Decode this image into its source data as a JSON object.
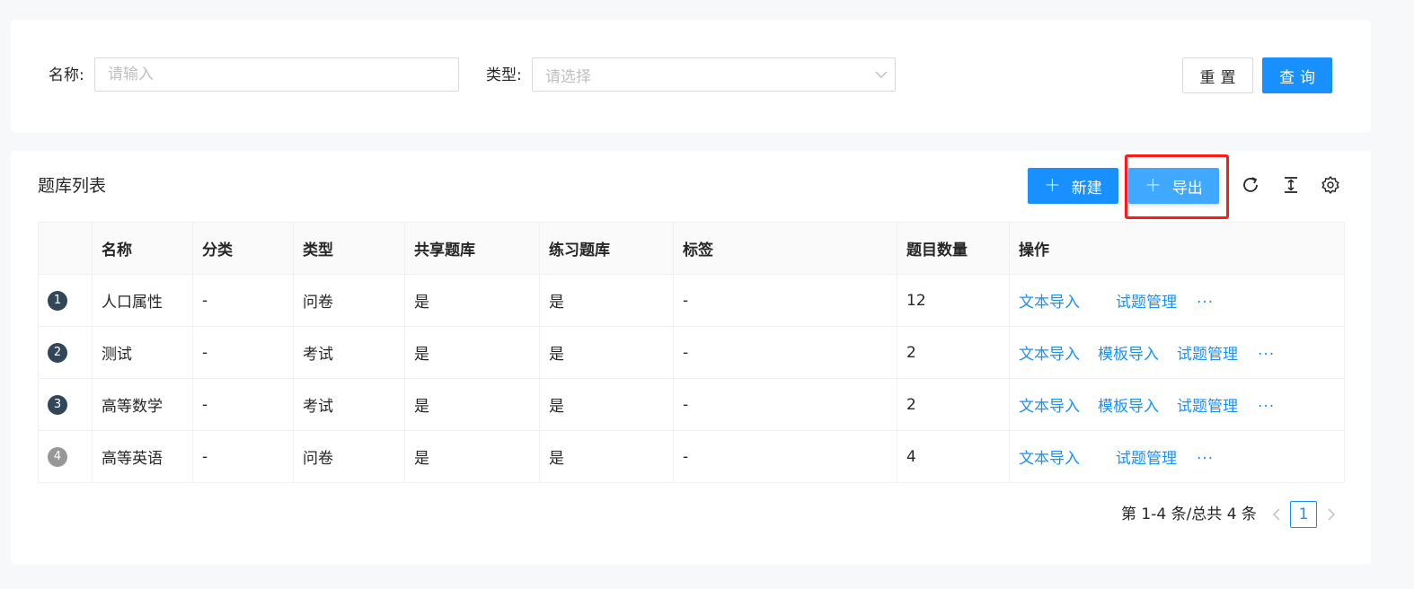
{
  "search": {
    "name_label": "名称:",
    "name_placeholder": "请输入",
    "type_label": "类型:",
    "type_placeholder": "请选择",
    "reset_label": "重置",
    "query_label": "查询"
  },
  "list": {
    "title": "题库列表",
    "new_label": "新建",
    "export_label": "导出",
    "icons": [
      "reload-icon",
      "column-height-icon",
      "setting-icon"
    ]
  },
  "table": {
    "columns": [
      "",
      "名称",
      "分类",
      "类型",
      "共享题库",
      "练习题库",
      "标签",
      "题目数量",
      "操作"
    ],
    "rows": [
      {
        "index": "1",
        "name": "人口属性",
        "category": "-",
        "type": "问卷",
        "shared": "是",
        "practice": "是",
        "tags": "-",
        "count": "12",
        "actions": [
          "文本导入",
          "试题管理"
        ],
        "more": "···",
        "badge_color": "#314659"
      },
      {
        "index": "2",
        "name": "测试",
        "category": "-",
        "type": "考试",
        "shared": "是",
        "practice": "是",
        "tags": "-",
        "count": "2",
        "actions": [
          "文本导入",
          "模板导入",
          "试题管理"
        ],
        "more": "···",
        "badge_color": "#314659"
      },
      {
        "index": "3",
        "name": "高等数学",
        "category": "-",
        "type": "考试",
        "shared": "是",
        "practice": "是",
        "tags": "-",
        "count": "2",
        "actions": [
          "文本导入",
          "模板导入",
          "试题管理"
        ],
        "more": "···",
        "badge_color": "#314659"
      },
      {
        "index": "4",
        "name": "高等英语",
        "category": "-",
        "type": "问卷",
        "shared": "是",
        "practice": "是",
        "tags": "-",
        "count": "4",
        "actions": [
          "文本导入",
          "试题管理"
        ],
        "more": "···",
        "badge_color": "#979797"
      }
    ]
  },
  "pagination": {
    "total_text": "第 1-4 条/总共 4 条",
    "current_page": "1"
  },
  "colors": {
    "primary": "#1890ff",
    "highlight": "#ff1a1a"
  }
}
